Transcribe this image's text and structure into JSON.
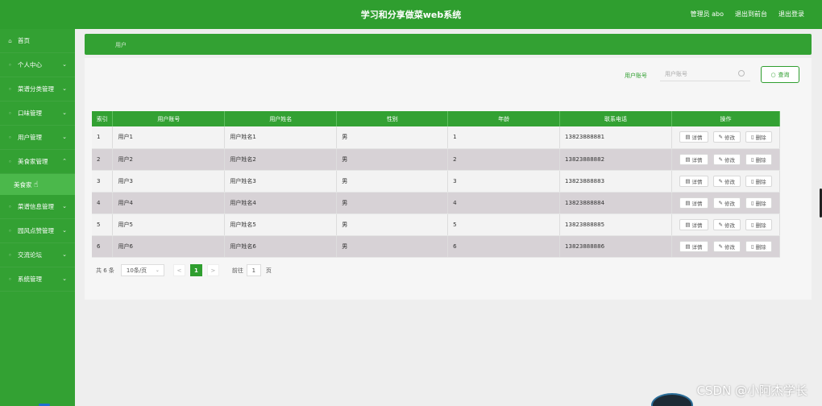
{
  "header": {
    "title": "学习和分享做菜web系统",
    "admin_label": "管理员 abo",
    "back_link": "退出到前台",
    "logout_link": "退出登录"
  },
  "sidebar": {
    "items": [
      {
        "label": "首页",
        "expandable": false
      },
      {
        "label": "个人中心",
        "expandable": true
      },
      {
        "label": "菜谱分类管理",
        "expandable": true
      },
      {
        "label": "口味管理",
        "expandable": true
      },
      {
        "label": "用户管理",
        "expandable": true
      },
      {
        "label": "美食家管理",
        "expandable": true,
        "expanded": true,
        "children": [
          {
            "label": "美食家"
          }
        ]
      },
      {
        "label": "菜谱信息管理",
        "expandable": true
      },
      {
        "label": "园风点赞管理",
        "expandable": true
      },
      {
        "label": "交流论坛",
        "expandable": true
      },
      {
        "label": "系统管理",
        "expandable": true
      }
    ]
  },
  "breadcrumb": {
    "text": "用户"
  },
  "search": {
    "label": "用户账号",
    "placeholder": "用户账号",
    "button_label": "查询"
  },
  "table": {
    "columns": [
      "索引",
      "用户账号",
      "用户姓名",
      "性别",
      "年龄",
      "联系电话",
      "操作"
    ],
    "rows": [
      {
        "index": "1",
        "account": "用户1",
        "name": "用户姓名1",
        "gender": "男",
        "age": "1",
        "phone": "13823888881"
      },
      {
        "index": "2",
        "account": "用户2",
        "name": "用户姓名2",
        "gender": "男",
        "age": "2",
        "phone": "13823888882"
      },
      {
        "index": "3",
        "account": "用户3",
        "name": "用户姓名3",
        "gender": "男",
        "age": "3",
        "phone": "13823888883"
      },
      {
        "index": "4",
        "account": "用户4",
        "name": "用户姓名4",
        "gender": "男",
        "age": "4",
        "phone": "13823888884"
      },
      {
        "index": "5",
        "account": "用户5",
        "name": "用户姓名5",
        "gender": "男",
        "age": "5",
        "phone": "13823888885"
      },
      {
        "index": "6",
        "account": "用户6",
        "name": "用户姓名6",
        "gender": "男",
        "age": "6",
        "phone": "13823888886"
      }
    ],
    "actions": {
      "detail": "详情",
      "edit": "修改",
      "delete": "删除"
    }
  },
  "pagination": {
    "total": "共 6 条",
    "page_size": "10条/页",
    "current_page": "1",
    "goto_prefix": "前往",
    "goto_value": "1",
    "goto_suffix": "页",
    "prev": "<",
    "next": ">"
  },
  "watermark": "CSDN @小阿杰学长",
  "colors": {
    "primary": "#33a133",
    "header": "#2f9e2f",
    "submenu": "#4bb84b",
    "row_alt": "#d7d2d6"
  }
}
